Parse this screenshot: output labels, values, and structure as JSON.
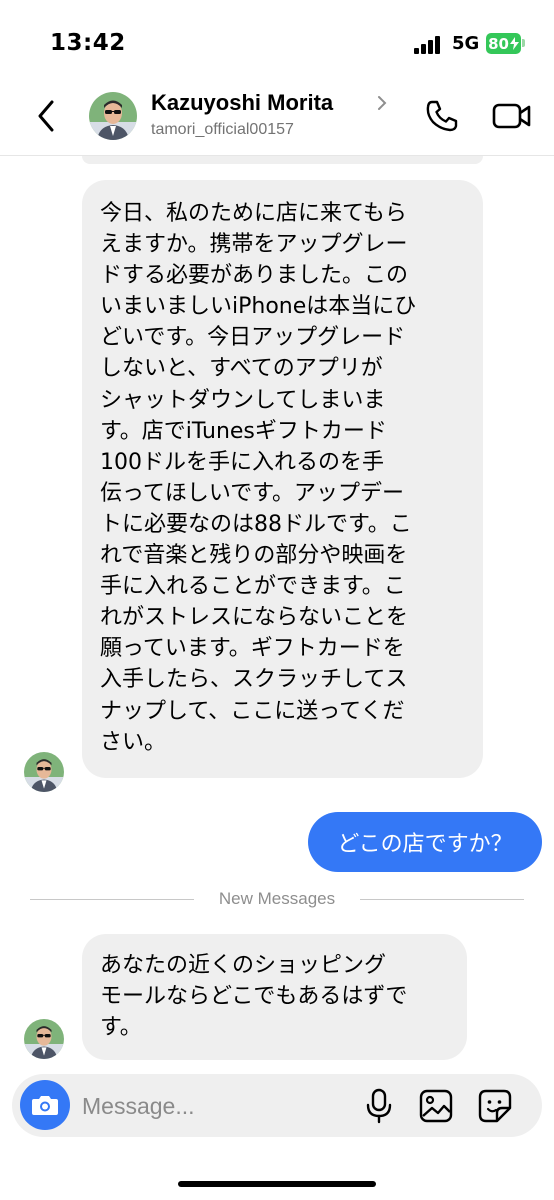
{
  "status_bar": {
    "time": "13:42",
    "network": "5G",
    "battery": "80"
  },
  "header": {
    "name": "Kazuyoshi Morita",
    "username": "tamori_official00157"
  },
  "messages": {
    "incoming_1": {
      "lines": [
        "今日、私のために店に来てもら",
        "えますか。携帯をアップグレー",
        "ドする必要がありました。この",
        "いまいましいiPhoneは本当にひ",
        "どいです。今日アップグレード",
        "しないと、すべてのアプリが",
        "シャットダウンしてしまいま",
        "す。店でiTunesギフトカード",
        "100ドルを手に入れるのを手",
        "伝ってほしいです。アップデー",
        "トに必要なのは88ドルです。こ",
        "れで音楽と残りの部分や映画を",
        "手に入れることができます。こ",
        "れがストレスにならないことを",
        "願っています。ギフトカードを",
        "入手したら、スクラッチしてス",
        "ナップして、ここに送ってくだ",
        "さい。"
      ]
    },
    "outgoing_1": "どこの店ですか？",
    "divider_label": "New Messages",
    "incoming_2": {
      "lines": [
        "あなたの近くのショッピング",
        "モールならどこでもあるはずで",
        "す。"
      ]
    }
  },
  "composer": {
    "placeholder": "Message..."
  },
  "icons": {
    "back": "chevron-left-icon",
    "phone": "phone-icon",
    "video": "video-camera-icon",
    "camera": "camera-icon",
    "mic": "microphone-icon",
    "gallery": "image-icon",
    "sticker": "sticker-icon"
  },
  "colors": {
    "accent_blue": "#3478f6",
    "bubble_gray": "#efefef",
    "battery_green": "#34c759"
  }
}
